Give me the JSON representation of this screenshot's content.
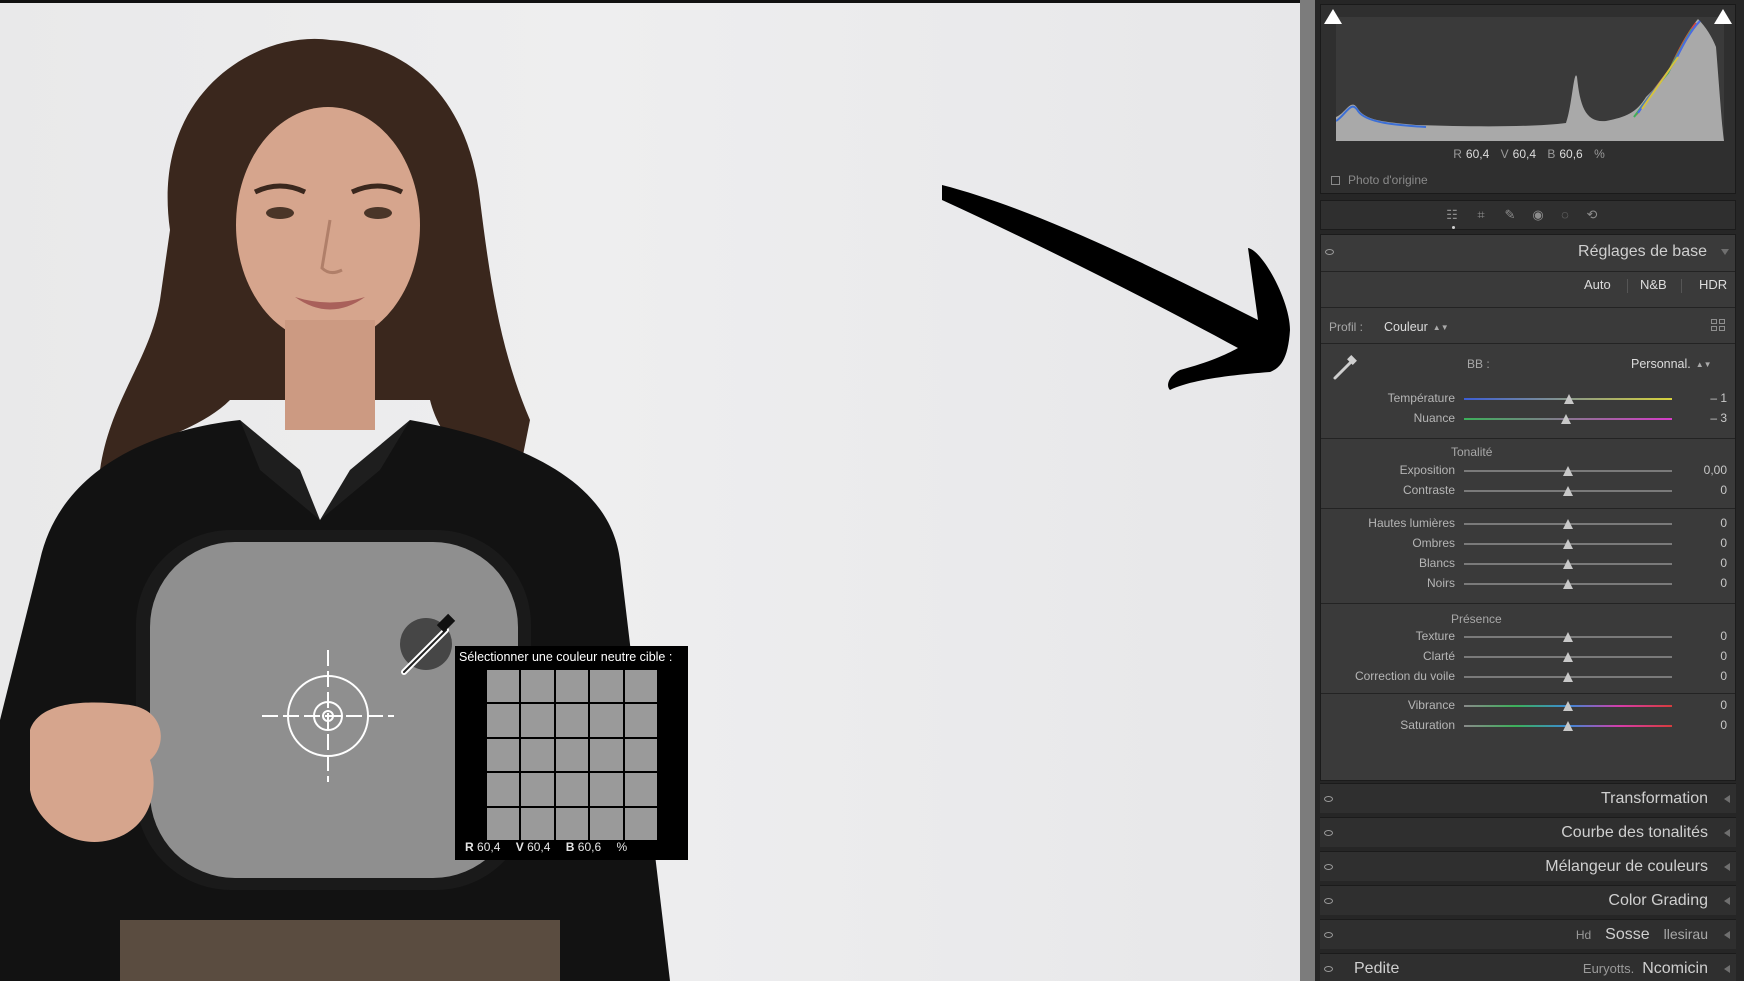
{
  "canvas": {
    "loupe": {
      "title": "Sélectionner une couleur neutre cible :",
      "readout": [
        {
          "key": "R",
          "value": "60,4"
        },
        {
          "key": "V",
          "value": "60,4"
        },
        {
          "key": "B",
          "value": "60,6"
        }
      ],
      "unit": "%"
    }
  },
  "histogram": {
    "readout": [
      {
        "key": "R",
        "value": "60,4"
      },
      {
        "key": "V",
        "value": "60,4"
      },
      {
        "key": "B",
        "value": "60,6"
      }
    ],
    "unit": "%",
    "original_photo_label": "Photo d'origine"
  },
  "tools": [
    "sliders-icon",
    "crop-icon",
    "heal-icon",
    "redeye-icon",
    "mask-icon",
    "rotate-icon"
  ],
  "basic": {
    "title": "Réglages de base",
    "buttons": {
      "auto": "Auto",
      "bw": "N&B",
      "hdr": "HDR"
    },
    "profile": {
      "label": "Profil :",
      "value": "Couleur"
    },
    "wb": {
      "label": "BB :",
      "value": "Personnal."
    },
    "sliders": {
      "temperature": {
        "label": "Température",
        "value": "– 1",
        "pos": 0.505
      },
      "tint": {
        "label": "Nuance",
        "value": "– 3",
        "pos": 0.49
      },
      "exposure": {
        "label": "Exposition",
        "value": "0,00",
        "pos": 0.5
      },
      "contrast": {
        "label": "Contraste",
        "value": "0",
        "pos": 0.5
      },
      "highlights": {
        "label": "Hautes lumières",
        "value": "0",
        "pos": 0.5
      },
      "shadows": {
        "label": "Ombres",
        "value": "0",
        "pos": 0.5
      },
      "whites": {
        "label": "Blancs",
        "value": "0",
        "pos": 0.5
      },
      "blacks": {
        "label": "Noirs",
        "value": "0",
        "pos": 0.5
      },
      "texture": {
        "label": "Texture",
        "value": "0",
        "pos": 0.5
      },
      "clarity": {
        "label": "Clarté",
        "value": "0",
        "pos": 0.5
      },
      "dehaze": {
        "label": "Correction du voile",
        "value": "0",
        "pos": 0.5
      },
      "vibrance": {
        "label": "Vibrance",
        "value": "0",
        "pos": 0.5
      },
      "saturation": {
        "label": "Saturation",
        "value": "0",
        "pos": 0.5
      }
    },
    "groups": {
      "tone": "Tonalité",
      "presence": "Présence"
    }
  },
  "sections": {
    "transform": "Transformation",
    "tone_curve": "Courbe des tonalités",
    "color_mixer": "Mélangeur de couleurs",
    "color_grading": "Color Grading",
    "partial_1": "Sosse",
    "partial_1_left_a": "Hd",
    "partial_1_right": "llesirau",
    "partial_2_left": "Pedite",
    "partial_2_mid": "Euryotts.",
    "partial_2_right": "Ncomicin"
  },
  "colors": {
    "panel_bg": "#3a3a3a",
    "panel_dark": "#262626",
    "accent": "#dcdcdc"
  }
}
